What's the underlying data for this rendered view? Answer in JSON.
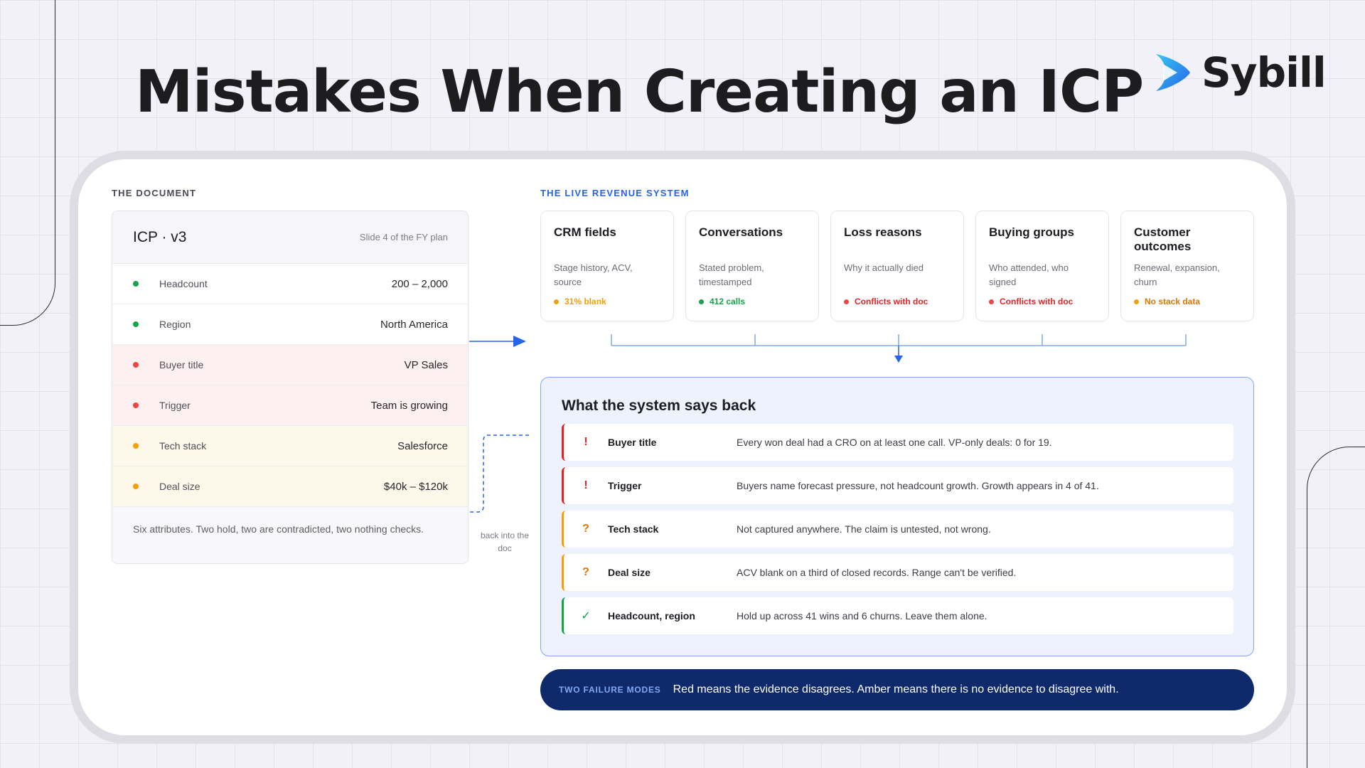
{
  "title": "Mistakes When Creating an ICP",
  "logo": {
    "name": "Sybill"
  },
  "colors": {
    "green": "#16a34a",
    "red": "#dc2626",
    "amber": "#f59e0b",
    "blue": "#2563eb",
    "navy": "#0f2a6b"
  },
  "document": {
    "section_label": "THE DOCUMENT",
    "title": "ICP · v3",
    "subtitle": "Slide 4 of the FY plan",
    "rows": [
      {
        "key": "Headcount",
        "value": "200 – 2,000",
        "status": "green"
      },
      {
        "key": "Region",
        "value": "North America",
        "status": "green"
      },
      {
        "key": "Buyer title",
        "value": "VP Sales",
        "status": "red"
      },
      {
        "key": "Trigger",
        "value": "Team is growing",
        "status": "red"
      },
      {
        "key": "Tech stack",
        "value": "Salesforce",
        "status": "amber"
      },
      {
        "key": "Deal size",
        "value": "$40k – $120k",
        "status": "amber"
      }
    ],
    "footer": "Six attributes. Two hold, two are contradicted, two nothing checks.",
    "back_label": "back into the doc"
  },
  "live_system": {
    "section_label": "THE LIVE REVENUE SYSTEM",
    "sources": [
      {
        "title": "CRM fields",
        "desc": "Stage history, ACV, source",
        "status": "31% blank",
        "status_color": "amber"
      },
      {
        "title": "Conversations",
        "desc": "Stated problem, timestamped",
        "status": "412 calls",
        "status_color": "green"
      },
      {
        "title": "Loss reasons",
        "desc": "Why it actually died",
        "status": "Conflicts with doc",
        "status_color": "red"
      },
      {
        "title": "Buying groups",
        "desc": "Who attended, who signed",
        "status": "Conflicts with doc",
        "status_color": "red"
      },
      {
        "title": "Customer outcomes",
        "desc": "Renewal, expansion, churn",
        "status": "No stack data",
        "status_color": "amber"
      }
    ]
  },
  "says_back": {
    "title": "What the system says back",
    "rows": [
      {
        "mark": "!",
        "key": "Buyer title",
        "text": "Every won deal had a CRO on at least one call. VP-only deals: 0 for 19.",
        "status": "red"
      },
      {
        "mark": "!",
        "key": "Trigger",
        "text": "Buyers name forecast pressure, not headcount growth. Growth appears in 4 of 41.",
        "status": "red"
      },
      {
        "mark": "?",
        "key": "Tech stack",
        "text": "Not captured anywhere. The claim is untested, not wrong.",
        "status": "amber"
      },
      {
        "mark": "?",
        "key": "Deal size",
        "text": "ACV blank on a third of closed records. Range can't be verified.",
        "status": "amber"
      },
      {
        "mark": "✓",
        "key": "Headcount, region",
        "text": "Hold up across 41 wins and 6 churns. Leave them alone.",
        "status": "green"
      }
    ]
  },
  "banner": {
    "tag": "TWO FAILURE MODES",
    "text": "Red means the evidence disagrees. Amber means there is no evidence to disagree with."
  }
}
